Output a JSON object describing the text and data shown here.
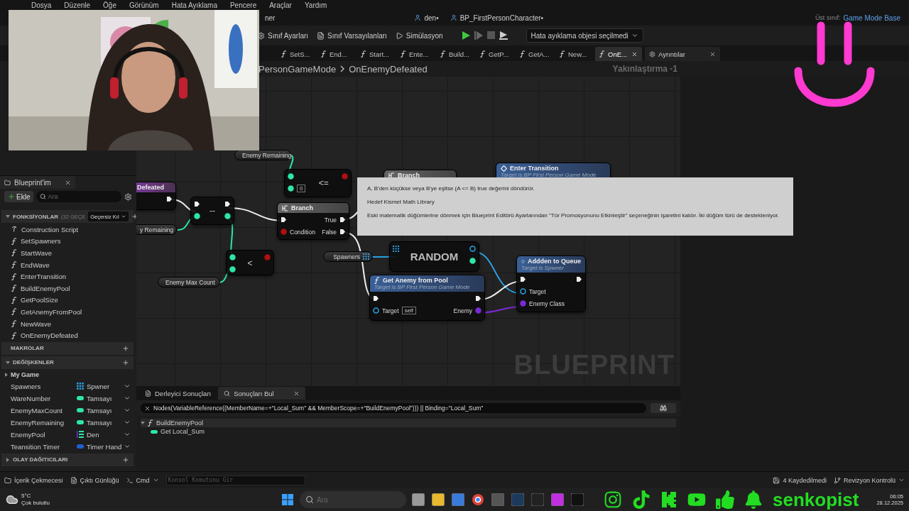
{
  "menu": [
    "Dosya",
    "Düzenle",
    "Öğe",
    "Görünüm",
    "Hata Ayıklama",
    "Pencere",
    "Araçlar",
    "Yardım"
  ],
  "doc_tabs": [
    {
      "label": "ner",
      "kind": "plain",
      "selected": false
    },
    {
      "label": "den•",
      "kind": "person",
      "selected": false
    },
    {
      "label": "BP_FirstPersonCharacter•",
      "kind": "person",
      "selected": false
    }
  ],
  "parent_class": {
    "label": "Üst sınıf:",
    "value": "Game Mode Base"
  },
  "toolbar": {
    "buttons": [
      {
        "kind": "settings",
        "label": "Sınıf Ayarları"
      },
      {
        "kind": "defaults",
        "label": "Sınıf Varsayılanları"
      },
      {
        "kind": "simulate",
        "label": "Simülasyon"
      }
    ],
    "debug_object": "Hata ayıklama objesi seçilmedi"
  },
  "function_tabs": [
    {
      "label": "SetS...",
      "selected": false
    },
    {
      "label": "End...",
      "selected": false
    },
    {
      "label": "Start...",
      "selected": false
    },
    {
      "label": "Ente...",
      "selected": false
    },
    {
      "label": "Build...",
      "selected": false
    },
    {
      "label": "GetP...",
      "selected": false
    },
    {
      "label": "GetA...",
      "selected": false
    },
    {
      "label": "New...",
      "selected": false
    },
    {
      "label": "OnE...",
      "selected": true
    }
  ],
  "details_tab": "Ayrıntılar",
  "breadcrumb": [
    "PersonGameMode",
    "OnEnemyDefeated"
  ],
  "zoom": "Yakınlaştırma -1",
  "my_blueprint": {
    "title": "Blueprint'im",
    "add": "Ekle",
    "search_placeholder": "Ara",
    "functions_section": {
      "title": "FONKSİYONLAR",
      "count": "(32 GEÇE",
      "override": "Geçersiz Kıl",
      "expanded": true
    },
    "functions": [
      {
        "kind": "construction",
        "label": "Construction Script"
      },
      {
        "kind": "function",
        "label": "SetSpawners"
      },
      {
        "kind": "function",
        "label": "StartWave"
      },
      {
        "kind": "function",
        "label": "EndWave"
      },
      {
        "kind": "function",
        "label": "EnterTransition"
      },
      {
        "kind": "function",
        "label": "BuildEnemyPool"
      },
      {
        "kind": "function",
        "label": "GetPoolSize"
      },
      {
        "kind": "function",
        "label": "GetAnemyFromPool"
      },
      {
        "kind": "function",
        "label": "NewWave"
      },
      {
        "kind": "function",
        "label": "OnEnemyDefeated"
      }
    ],
    "macros_section": {
      "title": "MAKROLAR"
    },
    "variables_section": {
      "title": "DEĞİŞKENLER",
      "expanded": true
    },
    "category": {
      "label": "My Game",
      "expanded": false
    },
    "variables": [
      {
        "name": "Spawners",
        "type": "Spwner",
        "kind": "array",
        "color": "#2a9fe0"
      },
      {
        "name": "WareNumber",
        "type": "Tamsayı",
        "kind": "single",
        "color": "#2ee6a8"
      },
      {
        "name": "EnemyMaxCount",
        "type": "Tamsayı",
        "kind": "single",
        "color": "#2ee6a8"
      },
      {
        "name": "EnemyRemaining",
        "type": "Tamsayı",
        "kind": "single",
        "color": "#2ee6a8"
      },
      {
        "name": "EnemyPool",
        "type": "Den",
        "kind": "list",
        "color": "#2ee6a8"
      },
      {
        "name": "Teansition Timer",
        "type": "Timer Hand",
        "kind": "single",
        "color": "#2060d0"
      }
    ],
    "dispatchers_section": {
      "title": "OLAY DAĞITICILARI",
      "expanded": false
    }
  },
  "graph": {
    "nodes": [
      {
        "kind": "getter",
        "title": "Enemy Remaining",
        "outputs": [
          {
            "kind": "int"
          }
        ]
      },
      {
        "kind": "event",
        "title": "Defeated",
        "outputs": [
          {
            "kind": "exec"
          }
        ]
      },
      {
        "kind": "operator",
        "title": "<=",
        "inputs": [
          {
            "kind": "int"
          },
          {
            "kind": "int",
            "value": "0"
          }
        ],
        "outputs": [
          {
            "kind": "bool"
          }
        ]
      },
      {
        "kind": "branch",
        "title": "Branch"
      },
      {
        "kind": "function",
        "title": "Enter Transition",
        "subtitle": "Target is BP First Person Game Mode"
      },
      {
        "kind": "getter",
        "title": "y Remaining",
        "outputs": [
          {
            "kind": "int"
          }
        ]
      },
      {
        "kind": "operator",
        "title": "--",
        "inputs": [
          {
            "kind": "exec"
          },
          {
            "kind": "int"
          }
        ],
        "outputs": [
          {
            "kind": "exec"
          },
          {
            "kind": "int"
          }
        ]
      },
      {
        "kind": "branch",
        "title": "Branch",
        "inputs": [
          {
            "kind": "exec"
          },
          {
            "kind": "bool",
            "label": "Condition"
          }
        ],
        "outputs": [
          {
            "kind": "exec",
            "label": "True"
          },
          {
            "kind": "exec",
            "label": "False"
          }
        ]
      },
      {
        "kind": "operator",
        "title": "<",
        "inputs": [
          {
            "kind": "int"
          },
          {
            "kind": "int"
          }
        ],
        "outputs": [
          {
            "kind": "bool"
          }
        ]
      },
      {
        "kind": "getter",
        "title": "Spawners",
        "outputs": [
          {
            "kind": "array"
          }
        ]
      },
      {
        "kind": "random",
        "title": "RANDOM",
        "inputs": [
          {
            "kind": "array"
          }
        ],
        "outputs": [
          {
            "kind": "object"
          },
          {
            "kind": "int"
          }
        ]
      },
      {
        "kind": "getter",
        "title": "Enemy Max Count",
        "outputs": [
          {
            "kind": "int"
          }
        ]
      },
      {
        "kind": "function",
        "title": "Get Anemy from Pool",
        "subtitle": "Target is BP First Person Game Mode",
        "inputs": [
          {
            "kind": "exec"
          },
          {
            "kind": "object",
            "label": "Target",
            "value": "self"
          }
        ],
        "outputs": [
          {
            "kind": "exec"
          },
          {
            "kind": "class",
            "label": "Enemy"
          }
        ]
      },
      {
        "kind": "function",
        "title": "Addden to Queue",
        "subtitle": "Target is Spwner",
        "inputs": [
          {
            "kind": "exec"
          },
          {
            "kind": "object",
            "label": "Target"
          },
          {
            "kind": "class",
            "label": "Enemy Class"
          }
        ],
        "outputs": [
          {
            "kind": "exec"
          }
        ]
      }
    ],
    "watermark": "BLUEPRINT",
    "tooltip": [
      "A, B'den küçükse veya B'ye eşitse (A <= B) true değerini döndürür.",
      "Hedef Kismet Math Library",
      "Eski matematik düğümlerine dönmek için Blueprint Editörü Ayarlarından \"Tür Promosyonunu Etkinleştir\" seçeneğinin işaretini kaldır. İki düğüm türü de destekleniyor."
    ]
  },
  "results_panel": {
    "tabs": [
      {
        "kind": "compiler",
        "label": "Derleyici Sonuçları",
        "selected": false
      },
      {
        "kind": "find",
        "label": "Sonuçları Bul",
        "selected": true
      }
    ],
    "query": "Nodes(VariableReference((MemberName=+\"Local_Sum\" && MemberScope=+\"BuildEnemyPool\"))) || Binding=\"Local_Sum\"",
    "results": [
      {
        "kind": "function",
        "label": "BuildEnemyPool",
        "expanded": true,
        "children": [
          {
            "kind": "variable",
            "label": "Get Local_Sum"
          }
        ]
      }
    ]
  },
  "status_bar": {
    "left": [
      {
        "kind": "drawer",
        "label": "İçerik Çekmecesi"
      },
      {
        "kind": "log",
        "label": "Çıktı Günlüğü"
      }
    ],
    "cmd": "Cmd",
    "console_placeholder": "Konsol Komutunu Gir",
    "unsaved": "4 Kaydedilmedi",
    "revision": "Revizyon Kontrolü"
  },
  "taskbar": {
    "weather": {
      "temp": "5°C",
      "desc": "Çok bulutlu"
    },
    "search_placeholder": "Ara",
    "apps": [
      {
        "kind": "taskview"
      },
      {
        "kind": "explorer"
      },
      {
        "kind": "store"
      },
      {
        "kind": "chrome"
      },
      {
        "kind": "obs"
      },
      {
        "kind": "steam"
      },
      {
        "kind": "epic"
      },
      {
        "kind": "purple"
      },
      {
        "kind": "unreal"
      }
    ],
    "overlay": {
      "icons": [
        {
          "kind": "camera"
        },
        {
          "kind": "note"
        },
        {
          "kind": "k"
        },
        {
          "kind": "play"
        },
        {
          "kind": "thumb"
        },
        {
          "kind": "bell"
        }
      ],
      "name": "senkopist"
    },
    "time": "06:05",
    "date": "28.12.2025"
  }
}
